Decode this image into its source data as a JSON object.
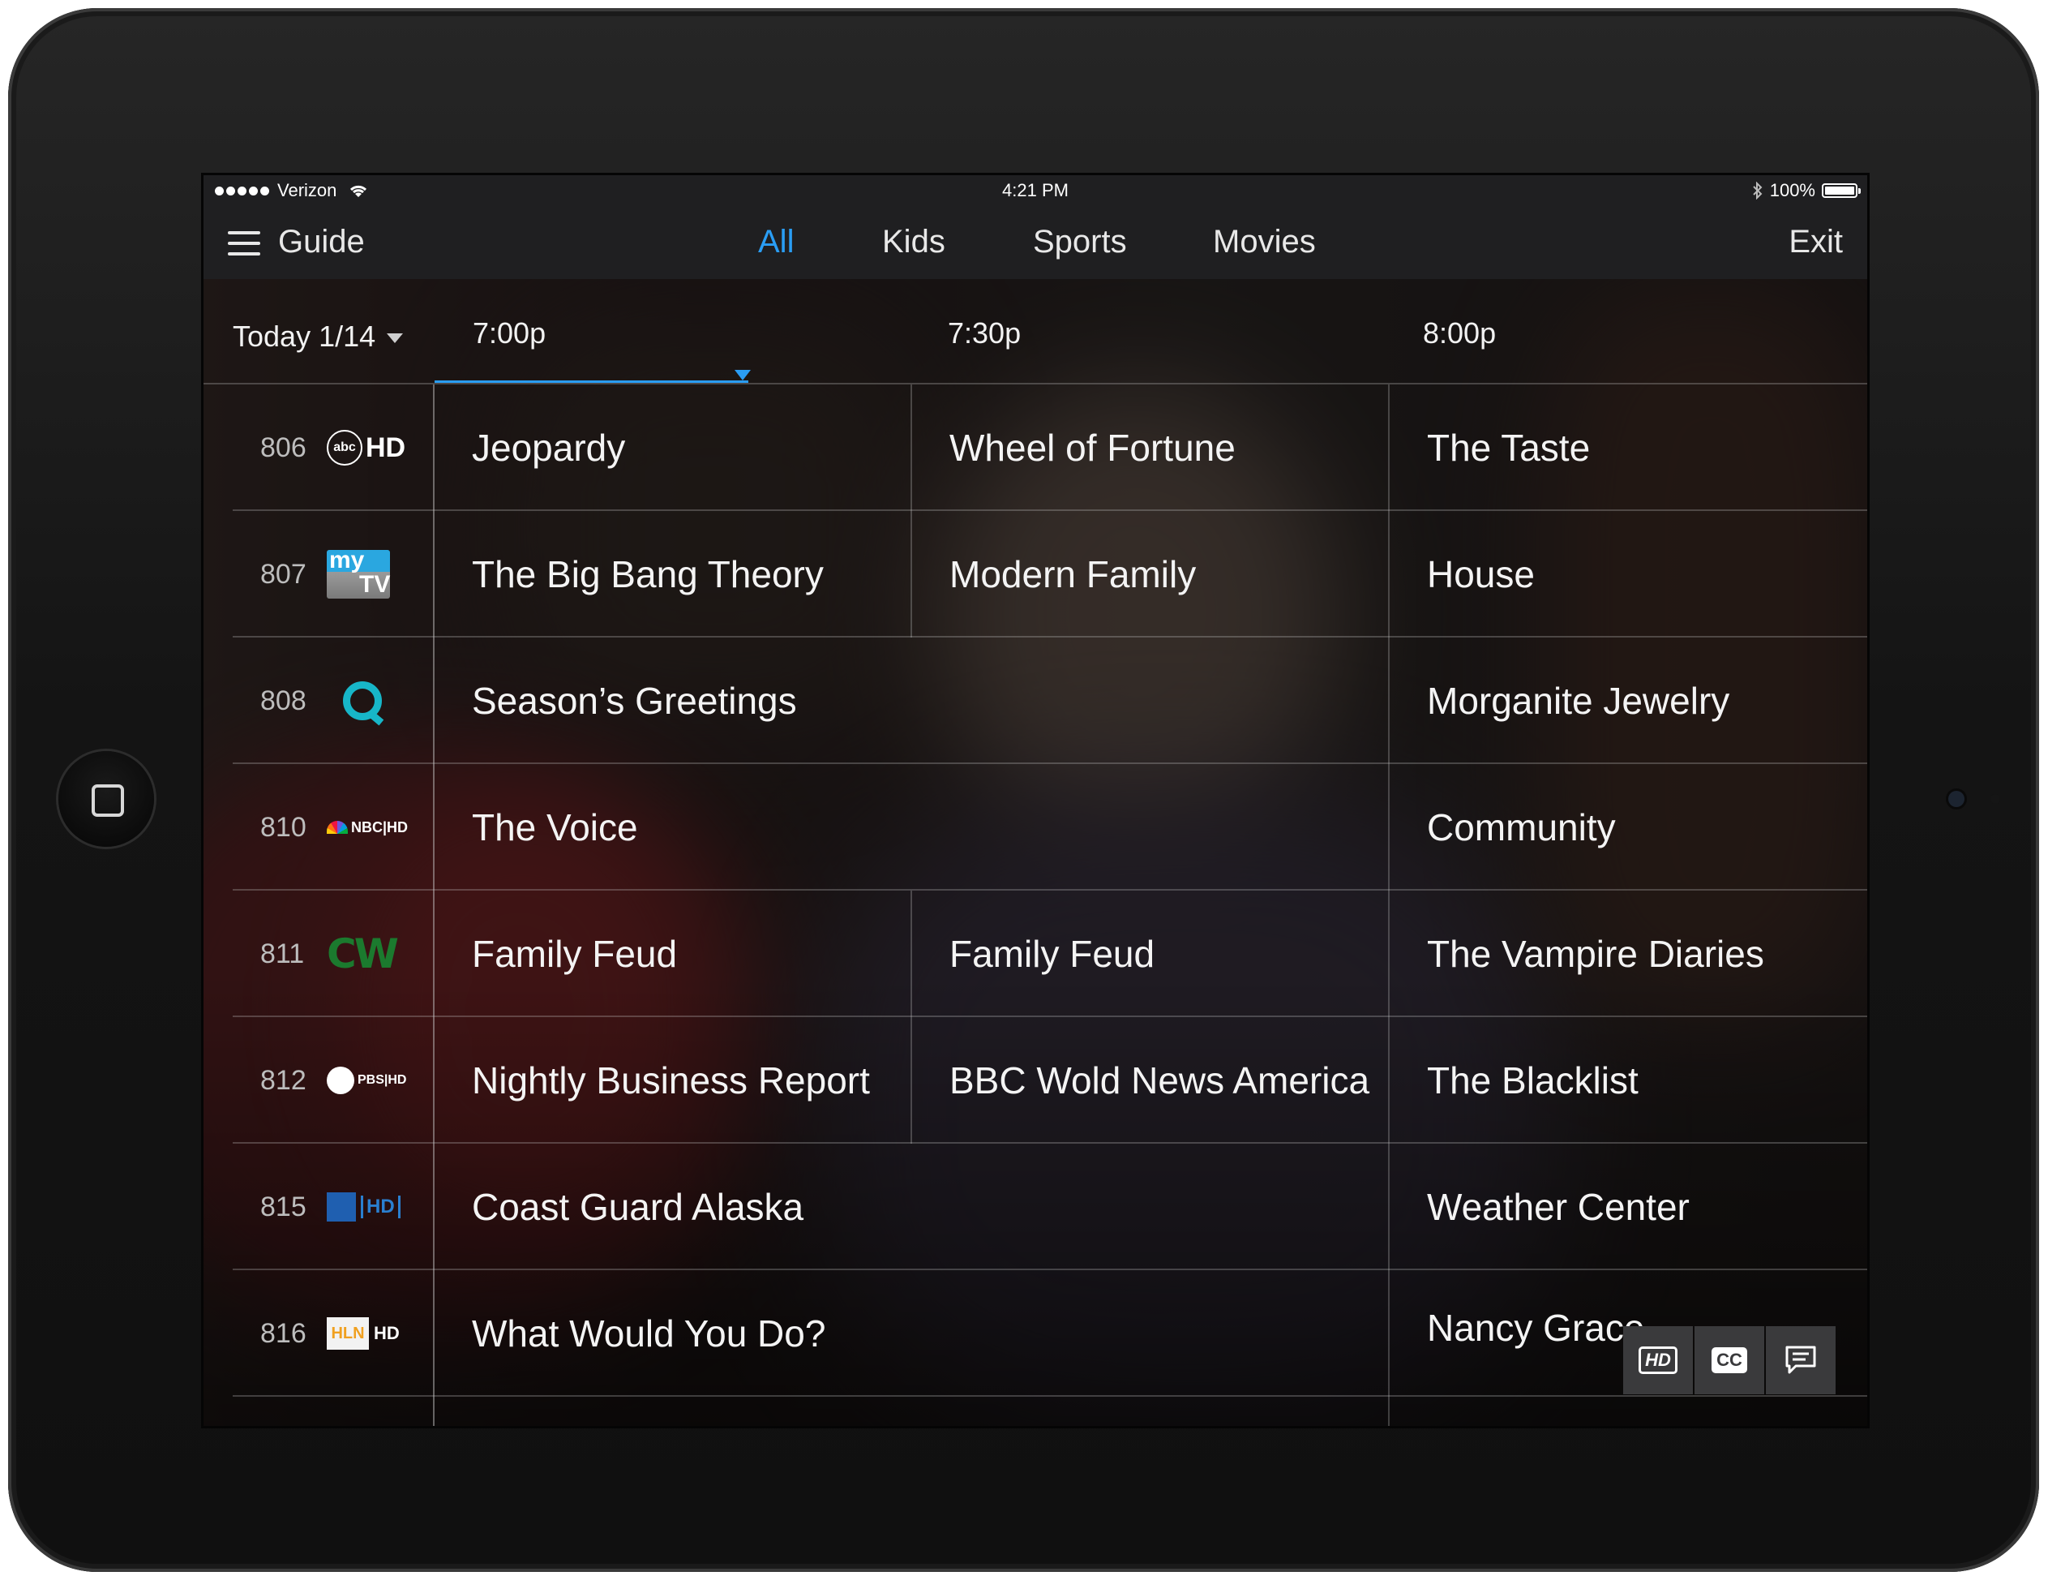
{
  "status_bar": {
    "carrier": "Verizon",
    "time": "4:21 PM",
    "battery": "100%"
  },
  "nav": {
    "title": "Guide",
    "tabs": [
      {
        "label": "All",
        "active": true
      },
      {
        "label": "Kids",
        "active": false
      },
      {
        "label": "Sports",
        "active": false
      },
      {
        "label": "Movies",
        "active": false
      }
    ],
    "exit_label": "Exit"
  },
  "guide": {
    "date_label": "Today 1/14",
    "time_slots": [
      "7:00p",
      "7:30p",
      "8:00p"
    ],
    "channels": [
      {
        "number": "806",
        "logo": "abc-hd-logo",
        "programs": [
          {
            "title": "Jeopardy",
            "span": 1
          },
          {
            "title": "Wheel of Fortune",
            "span": 1
          },
          {
            "title": "The Taste",
            "span": 1
          }
        ]
      },
      {
        "number": "807",
        "logo": "mynetwork-tv-logo",
        "programs": [
          {
            "title": "The Big Bang Theory",
            "span": 1
          },
          {
            "title": "Modern Family",
            "span": 1
          },
          {
            "title": "House",
            "span": 1
          }
        ]
      },
      {
        "number": "808",
        "logo": "qvc-hd-logo",
        "programs": [
          {
            "title": "Season’s Greetings",
            "span": 2
          },
          {
            "title": "Morganite Jewelry",
            "span": 1
          }
        ]
      },
      {
        "number": "810",
        "logo": "nbc-hd-logo",
        "programs": [
          {
            "title": "The Voice",
            "span": 2
          },
          {
            "title": "Community",
            "span": 1
          }
        ]
      },
      {
        "number": "811",
        "logo": "cw-logo",
        "programs": [
          {
            "title": "Family Feud",
            "span": 1
          },
          {
            "title": "Family Feud",
            "span": 1
          },
          {
            "title": "The Vampire Diaries",
            "span": 1
          }
        ]
      },
      {
        "number": "812",
        "logo": "pbs-hd-logo",
        "programs": [
          {
            "title": "Nightly Business Report",
            "span": 1
          },
          {
            "title": "BBC Wold News America",
            "span": 1
          },
          {
            "title": "The Blacklist",
            "span": 1
          }
        ]
      },
      {
        "number": "815",
        "logo": "weather-channel-hd-logo",
        "programs": [
          {
            "title": "Coast Guard Alaska",
            "span": 2
          },
          {
            "title": "Weather Center",
            "span": 1
          }
        ]
      },
      {
        "number": "816",
        "logo": "hln-hd-logo",
        "programs": [
          {
            "title": "What Would You Do?",
            "span": 2
          },
          {
            "title": "Nancy Grace",
            "span": 1
          }
        ]
      }
    ]
  },
  "logo_text": {
    "abc_hd": "HD",
    "abc": "abc",
    "my": "my",
    "tv": "TV",
    "nbc": "NBC|HD",
    "cw": "CW",
    "pbs": "PBS|HD",
    "twc_hd": "HD",
    "hln": "HLN",
    "hln_hd": "HD"
  },
  "actions": {
    "hd_label": "HD",
    "cc_label": "CC"
  },
  "colors": {
    "accent": "#2a9df4",
    "bar_background": "#1f1f21"
  }
}
